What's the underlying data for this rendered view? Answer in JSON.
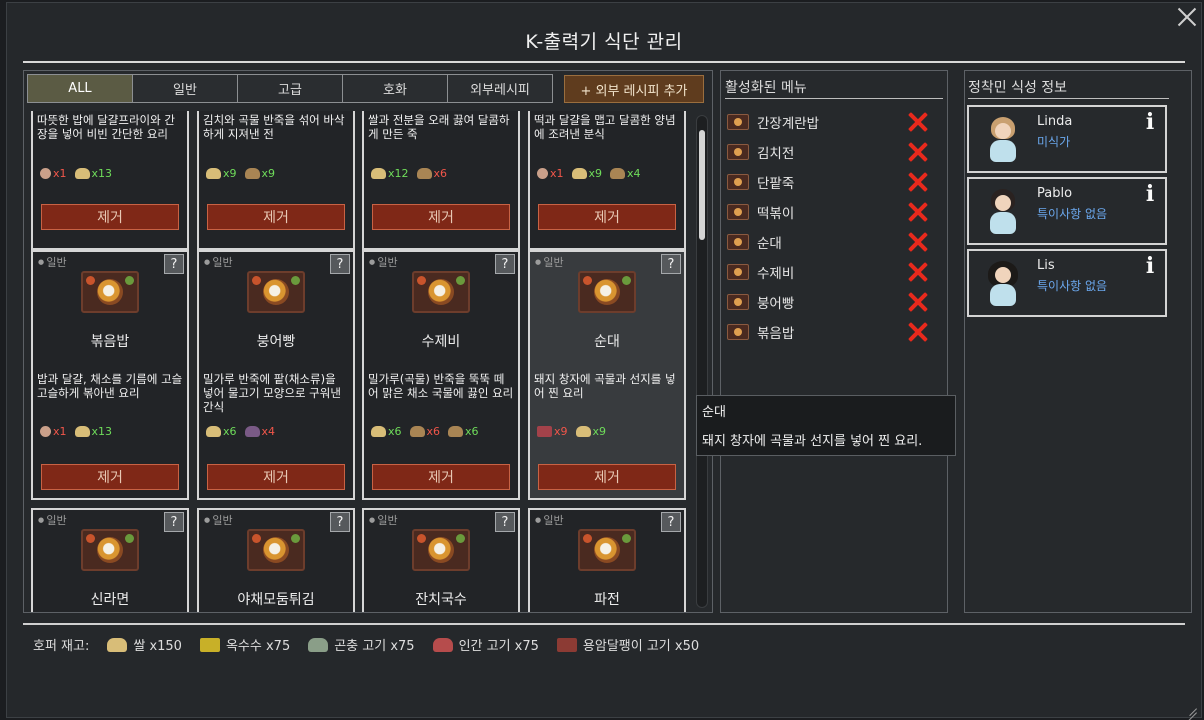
{
  "window": {
    "title": "K-출력기 식단 관리"
  },
  "tabs": [
    {
      "label": "ALL",
      "active": true
    },
    {
      "label": "일반",
      "active": false
    },
    {
      "label": "고급",
      "active": false
    },
    {
      "label": "호화",
      "active": false
    },
    {
      "label": "외부레시피",
      "active": false
    }
  ],
  "add_recipe_label": "+ 외부 레시피 추가",
  "remove_label": "제거",
  "help_label": "?",
  "top_cards": [
    {
      "desc": "따뜻한 밥에 달걀프라이와 간장을 넣어 비빈 간단한 요리",
      "ingredients": [
        {
          "icon": "egg-icon",
          "qty": "x1",
          "ok": false
        },
        {
          "icon": "rice-icon",
          "qty": "x13",
          "ok": true
        }
      ]
    },
    {
      "desc": "김치와 곡물 반죽을 섞어 바삭하게 지져낸 전",
      "ingredients": [
        {
          "icon": "rice-icon",
          "qty": "x9",
          "ok": true
        },
        {
          "icon": "grain-icon",
          "qty": "x9",
          "ok": true
        }
      ]
    },
    {
      "desc": "쌀과 전분을 오래 끓여 달콤하게 만든 죽",
      "ingredients": [
        {
          "icon": "rice-icon",
          "qty": "x12",
          "ok": true
        },
        {
          "icon": "grain-icon",
          "qty": "x6",
          "ok": false
        }
      ]
    },
    {
      "desc": "떡과 달걀을 맵고 달콤한 양념에 조려낸 분식",
      "ingredients": [
        {
          "icon": "egg-icon",
          "qty": "x1",
          "ok": false
        },
        {
          "icon": "rice-icon",
          "qty": "x9",
          "ok": true
        },
        {
          "icon": "grain-icon",
          "qty": "x4",
          "ok": true
        }
      ]
    }
  ],
  "mid_cards": [
    {
      "category": "일반",
      "name": "볶음밥",
      "desc": "밥과 달걀, 채소를 기름에 고슬고슬하게 볶아낸 요리",
      "ingredients": [
        {
          "icon": "egg-icon",
          "qty": "x1",
          "ok": false
        },
        {
          "icon": "rice-icon",
          "qty": "x13",
          "ok": true
        }
      ]
    },
    {
      "category": "일반",
      "name": "붕어빵",
      "desc": "밀가루 반죽에 팥(채소류)을 넣어 물고기 모양으로 구워낸 간식",
      "ingredients": [
        {
          "icon": "rice-icon",
          "qty": "x6",
          "ok": true
        },
        {
          "icon": "fish-icon",
          "qty": "x4",
          "ok": false
        }
      ]
    },
    {
      "category": "일반",
      "name": "수제비",
      "desc": "밀가루(곡물) 반죽을 뚝뚝 떼어 맑은 채소 국물에 끓인 요리",
      "ingredients": [
        {
          "icon": "rice-icon",
          "qty": "x6",
          "ok": true
        },
        {
          "icon": "grain-icon",
          "qty": "x6",
          "ok": false
        },
        {
          "icon": "grain-icon",
          "qty": "x6",
          "ok": true
        }
      ]
    },
    {
      "category": "일반",
      "name": "순대",
      "desc": "돼지 창자에 곡물과 선지를 넣어 찐 요리",
      "ingredients": [
        {
          "icon": "meat-icon",
          "qty": "x9",
          "ok": false
        },
        {
          "icon": "rice-icon",
          "qty": "x9",
          "ok": true
        }
      ]
    }
  ],
  "bottom_cards": [
    {
      "category": "일반",
      "name": "신라면"
    },
    {
      "category": "일반",
      "name": "야채모둠튀김"
    },
    {
      "category": "일반",
      "name": "잔치국수"
    },
    {
      "category": "일반",
      "name": "파전"
    }
  ],
  "active_menu": {
    "title": "활성화된 메뉴",
    "items": [
      "간장계란밥",
      "김치전",
      "단팥죽",
      "떡볶이",
      "순대",
      "수제비",
      "붕어빵",
      "볶음밥"
    ]
  },
  "colonists": {
    "title": "정착민 식성 정보",
    "list": [
      {
        "name": "Linda",
        "trait": "미식가",
        "hair": "#c9a070"
      },
      {
        "name": "Pablo",
        "trait": "특이사항 없음",
        "hair": "#2a2220"
      },
      {
        "name": "Lis",
        "trait": "특이사항 없음",
        "hair": "#1c1a18"
      }
    ]
  },
  "hopper": {
    "label": "호퍼 재고:",
    "items": [
      {
        "icon": "rice-icon",
        "text": "쌀 x150"
      },
      {
        "icon": "corn-icon",
        "text": "옥수수 x75"
      },
      {
        "icon": "insect-meat-icon",
        "text": "곤충 고기 x75"
      },
      {
        "icon": "human-meat-icon",
        "text": "인간 고기 x75"
      },
      {
        "icon": "lava-snail-meat-icon",
        "text": "용암달팽이 고기 x50"
      }
    ]
  },
  "tooltip": {
    "title": "순대",
    "body": "돼지 창자에 곡물과 선지를 넣어 찐 요리."
  }
}
